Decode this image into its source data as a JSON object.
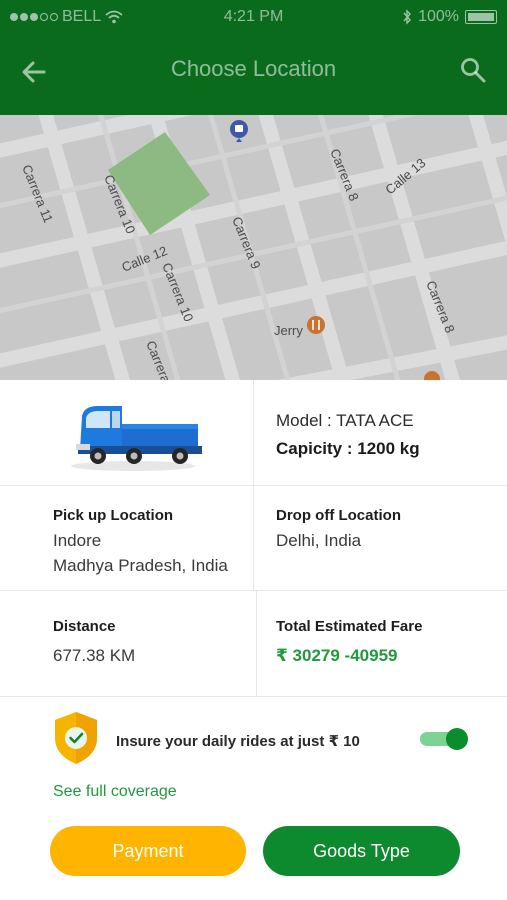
{
  "status_bar": {
    "carrier": "BELL",
    "time": "4:21 PM",
    "battery": "100%",
    "signal_dots": [
      "full",
      "full",
      "full",
      "empty",
      "empty"
    ],
    "icons": [
      "wifi-icon",
      "bluetooth-icon",
      "battery-icon"
    ]
  },
  "app_bar": {
    "title": "Choose Location",
    "back_icon": "back-arrow-icon",
    "search_icon": "search-icon"
  },
  "map": {
    "streets": [
      "Carrera 11",
      "Carrera 10",
      "Calle 12",
      "Carrera 10",
      "Carrera 9",
      "Carrera 8",
      "Calle 13",
      "Carrera 8",
      "Carrera"
    ],
    "poi": "Jerry"
  },
  "vehicle": {
    "model_label": "Model : TATA ACE",
    "capacity_label": "Capicity : 1200 kg"
  },
  "locations": {
    "pickup_heading": "Pick up Location",
    "pickup_line1": "Indore",
    "pickup_line2": "Madhya Pradesh, India",
    "dropoff_heading": "Drop off Location",
    "dropoff_line1": "Delhi, India"
  },
  "trip": {
    "distance_heading": "Distance",
    "distance_value": "677.38 KM",
    "fare_heading": "Total Estimated Fare",
    "fare_value": "₹ 30279 -40959"
  },
  "insurance": {
    "text": "Insure your daily rides at just ₹ 10",
    "enabled": true,
    "coverage_link": "See full coverage"
  },
  "actions": {
    "payment": "Payment",
    "goods_type": "Goods Type"
  },
  "colors": {
    "header": "#0a6b1d",
    "accent_green": "#1f9a3c",
    "button_green": "#0d8a2d",
    "button_orange": "#ffb400"
  }
}
